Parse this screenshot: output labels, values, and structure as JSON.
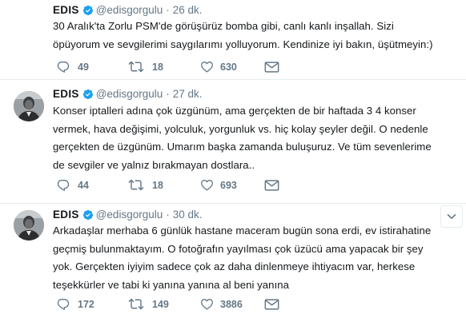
{
  "tweets": [
    {
      "name": "EDIS",
      "handle": "@edisgorgulu",
      "separator": "·",
      "time": "26 dk.",
      "lines": [
        "30 Aralık'ta Zorlu PSM'de görüşürüz bomba gibi, canlı kanlı inşallah. Sizi",
        "öpüyorum ve sevgilerimi saygılarımı yolluyorum. Kendinize iyi bakın, üşütmeyin:)"
      ],
      "replies": "49",
      "retweets": "18",
      "likes": "630"
    },
    {
      "name": "EDIS",
      "handle": "@edisgorgulu",
      "separator": "·",
      "time": "27 dk.",
      "lines": [
        "Konser iptalleri adına çok üzgünüm, ama gerçekten de bir haftada 3 4 konser",
        "vermek, hava değişimi, yolculuk, yorgunluk vs. hiç kolay şeyler değil. O nedenle",
        "gerçekten de üzgünüm. Umarım başka zamanda buluşuruz. Ve tüm sevenlerime",
        "de sevgiler ve yalnız bırakmayan dostlara.."
      ],
      "replies": "44",
      "retweets": "18",
      "likes": "693"
    },
    {
      "name": "EDIS",
      "handle": "@edisgorgulu",
      "separator": "·",
      "time": "30 dk.",
      "lines": [
        "Arkadaşlar merhaba 6 günlük hastane maceram bugün sona erdi, ev istirahatine",
        "geçmiş bulunmaktayım. O fotoğrafın yayılması çok üzücü ama yapacak bir şey",
        "yok. Gerçekten iyiyim sadece çok az daha dinlenmeye ihtiyacım var, herkese",
        "teşekkürler ve tabi ki yanına yanına al beni yanına"
      ],
      "replies": "172",
      "retweets": "149",
      "likes": "3886"
    }
  ],
  "icons": {
    "reply": "reply-icon",
    "retweet": "retweet-icon",
    "like": "heart-icon",
    "message": "envelope-icon",
    "verified": "verified-badge-icon",
    "caret": "chevron-down-icon"
  },
  "colors": {
    "verified": "#1da1f2",
    "meta": "#657786",
    "text": "#14171a",
    "divider": "#e6ecf0"
  }
}
